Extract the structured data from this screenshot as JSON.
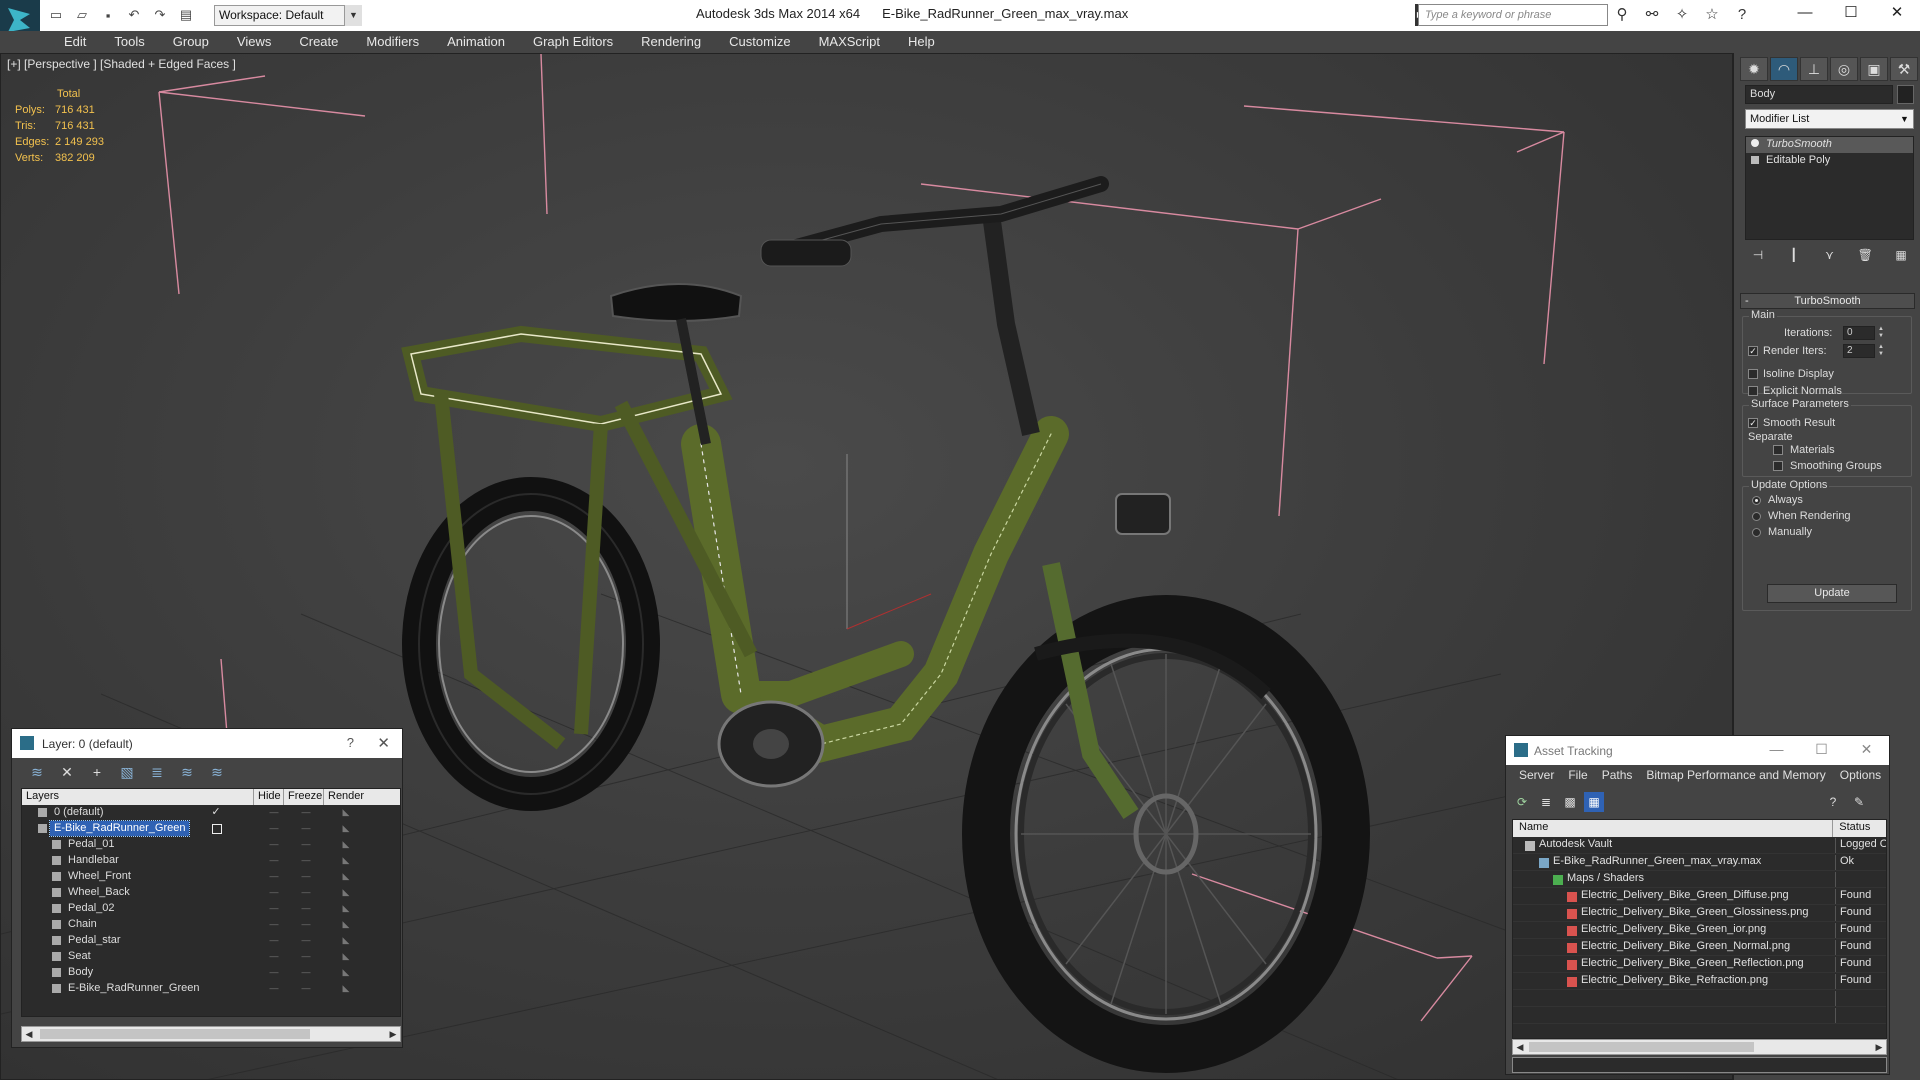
{
  "app": {
    "title": "Autodesk 3ds Max  2014 x64",
    "file": "E-Bike_RadRunner_Green_max_vray.max",
    "workspace": "Workspace: Default",
    "search_placeholder": "Type a keyword or phrase"
  },
  "menu": [
    "Edit",
    "Tools",
    "Group",
    "Views",
    "Create",
    "Modifiers",
    "Animation",
    "Graph Editors",
    "Rendering",
    "Customize",
    "MAXScript",
    "Help"
  ],
  "viewport": {
    "label": "[+] [Perspective ] [Shaded + Edged Faces ]",
    "stats": {
      "header": "Total",
      "polys_label": "Polys:",
      "polys": "716 431",
      "tris_label": "Tris:",
      "tris": "716 431",
      "edges_label": "Edges:",
      "edges": "2 149 293",
      "verts_label": "Verts:",
      "verts": "382 209"
    }
  },
  "command_panel": {
    "object_name": "Body",
    "modifier_list": "Modifier List",
    "stack": [
      "TurboSmooth",
      "Editable Poly"
    ],
    "rollout_title": "TurboSmooth",
    "main_group": "Main",
    "iterations_label": "Iterations:",
    "iterations": "0",
    "render_iters_label": "Render Iters:",
    "render_iters": "2",
    "isoline_label": "Isoline Display",
    "explicit_label": "Explicit Normals",
    "surface_group": "Surface Parameters",
    "smooth_result_label": "Smooth Result",
    "separate_label": "Separate",
    "materials_label": "Materials",
    "smoothing_groups_label": "Smoothing Groups",
    "update_group": "Update Options",
    "always_label": "Always",
    "when_rendering_label": "When Rendering",
    "manually_label": "Manually",
    "update_button": "Update"
  },
  "layer_dialog": {
    "title": "Layer: 0 (default)",
    "help": "?",
    "columns": [
      "Layers",
      "Hide",
      "Freeze",
      "Render"
    ],
    "rows": [
      {
        "name": "0 (default)"
      },
      {
        "name": "E-Bike_RadRunner_Green"
      },
      {
        "name": "Pedal_01"
      },
      {
        "name": "Handlebar"
      },
      {
        "name": "Wheel_Front"
      },
      {
        "name": "Wheel_Back"
      },
      {
        "name": "Pedal_02"
      },
      {
        "name": "Chain"
      },
      {
        "name": "Pedal_star"
      },
      {
        "name": "Seat"
      },
      {
        "name": "Body"
      },
      {
        "name": "E-Bike_RadRunner_Green"
      }
    ]
  },
  "asset_tracking": {
    "title": "Asset Tracking",
    "menu": [
      "Server",
      "File",
      "Paths",
      "Bitmap Performance and Memory",
      "Options"
    ],
    "columns": [
      "Name",
      "Status"
    ],
    "rows": [
      {
        "name": "Autodesk Vault",
        "status": "Logged Ou"
      },
      {
        "name": "E-Bike_RadRunner_Green_max_vray.max",
        "status": "Ok"
      },
      {
        "name": "Maps / Shaders",
        "status": ""
      },
      {
        "name": "Electric_Delivery_Bike_Green_Diffuse.png",
        "status": "Found"
      },
      {
        "name": "Electric_Delivery_Bike_Green_Glossiness.png",
        "status": "Found"
      },
      {
        "name": "Electric_Delivery_Bike_Green_ior.png",
        "status": "Found"
      },
      {
        "name": "Electric_Delivery_Bike_Green_Normal.png",
        "status": "Found"
      },
      {
        "name": "Electric_Delivery_Bike_Green_Reflection.png",
        "status": "Found"
      },
      {
        "name": "Electric_Delivery_Bike_Refraction.png",
        "status": "Found"
      }
    ]
  },
  "colors": {
    "viewport_bg": "#3c3c3c",
    "stats_text": "#f2c14e",
    "selection": "#2f62b4",
    "bbox_lines": "#d88aa0",
    "frame_green": "#5b6b2a"
  }
}
